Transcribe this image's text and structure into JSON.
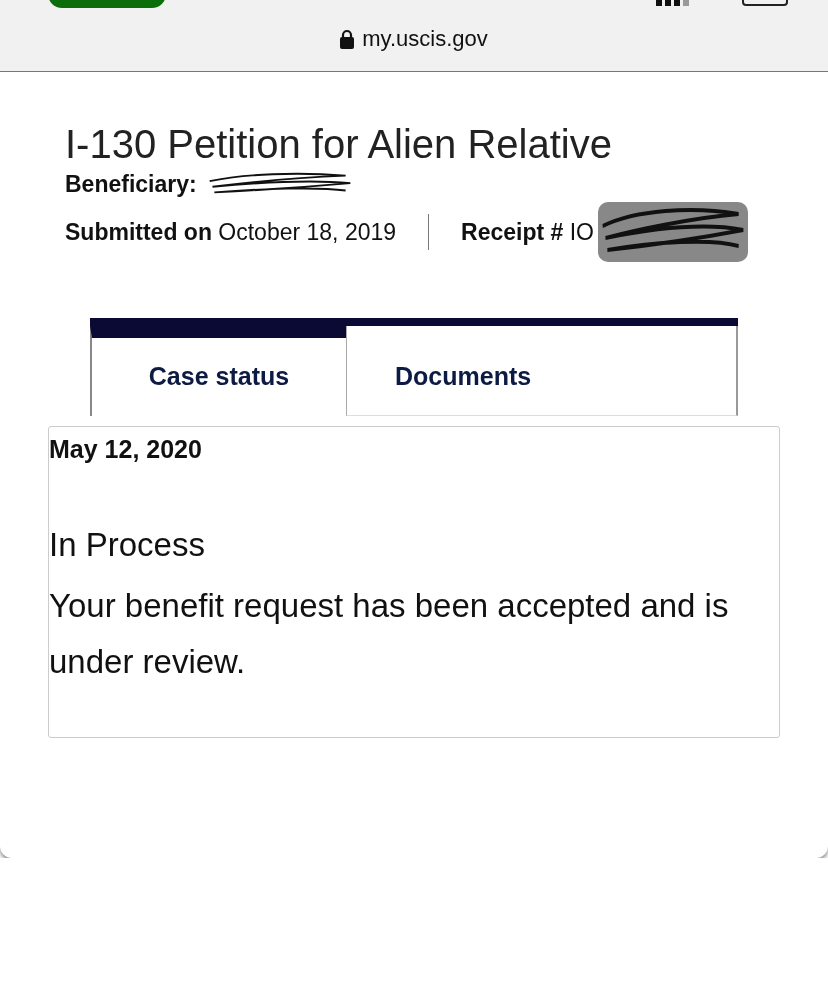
{
  "browser_bar": {
    "address": "my.uscis.gov"
  },
  "case": {
    "title": "I-130 Petition for Alien Relative",
    "beneficiary_label": "Beneficiary:",
    "submitted_label": "Submitted on",
    "submitted_date": "October 18, 2019",
    "receipt_label": "Receipt #",
    "receipt_value": "IO"
  },
  "tabs": [
    {
      "label": "Case status",
      "selected": true
    },
    {
      "label": "Documents",
      "selected": false
    }
  ],
  "status": {
    "date": "May 12, 2020",
    "title": "In Process",
    "description": "Your benefit request has been accepted and is under review."
  }
}
